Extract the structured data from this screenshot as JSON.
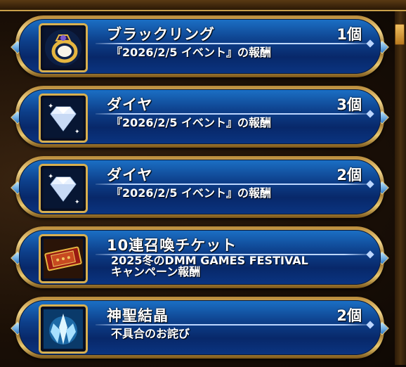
{
  "items": [
    {
      "name": "ブラックリング",
      "qty": "1個",
      "desc": "『2026/2/5 イベント』の報酬",
      "icon": "black-ring-icon"
    },
    {
      "name": "ダイヤ",
      "qty": "3個",
      "desc": "『2026/2/5 イベント』の報酬",
      "icon": "diamond-icon"
    },
    {
      "name": "ダイヤ",
      "qty": "2個",
      "desc": "『2026/2/5 イベント』の報酬",
      "icon": "diamond-icon"
    },
    {
      "name": "10連召喚チケット",
      "qty": "",
      "desc_line1": "2025冬のDMM GAMES FESTIVAL",
      "desc_line2": "キャンペーン報酬",
      "icon": "summon-ticket-icon"
    },
    {
      "name": "神聖結晶",
      "qty": "2個",
      "desc": "不具合のお詫び",
      "icon": "holy-crystal-icon"
    }
  ],
  "colors": {
    "panel_blue": "#0d3f8a",
    "gold_frame": "#d8b050"
  }
}
